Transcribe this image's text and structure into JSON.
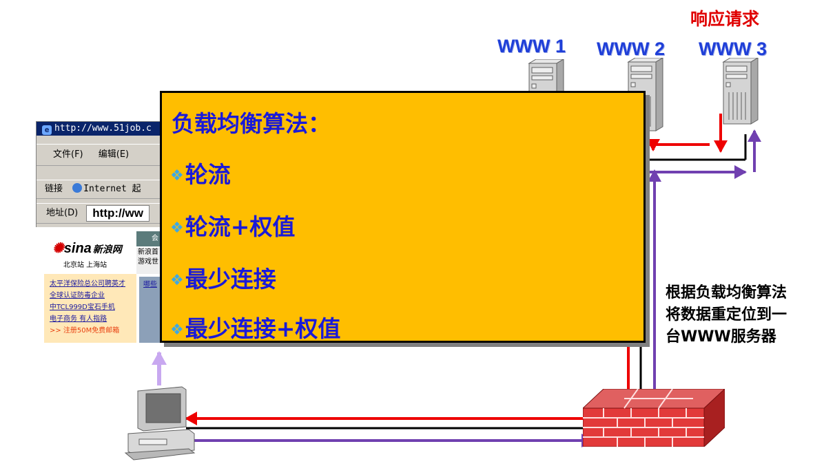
{
  "servers": {
    "request_label": "响应请求",
    "items": [
      {
        "label": "WWW 1"
      },
      {
        "label": "WWW 2"
      },
      {
        "label": "WWW 3"
      }
    ]
  },
  "browser": {
    "title": "http://www.51job.c",
    "menu": [
      "文件(F)",
      "编辑(E)"
    ],
    "links_label": "链接",
    "links_item": "Internet 起",
    "address_label": "地址(D)",
    "address_value": "http://ww"
  },
  "sina": {
    "logo": "sina",
    "logo_cn": "新浪网",
    "sub": "北京站  上海站",
    "tab": "会",
    "news": [
      "新浪首",
      "游戏世"
    ],
    "links": [
      "太平洋保险总公司聘英才",
      "全球认证防毒企业",
      "中TCL999D宝石手机",
      "电子商务 有人指路",
      ">> 注册50M免费邮箱"
    ],
    "pic_caption": "哪些"
  },
  "overlay": {
    "title": "负载均衡算法：",
    "items": [
      "轮流",
      "轮流+权值",
      "最少连接",
      "最少连接+权值"
    ]
  },
  "side_text": {
    "lines": [
      "根据负载均衡算法",
      "将数据重定位到一",
      "台WWW服务器"
    ]
  },
  "colors": {
    "red_arrow": "#ee0000",
    "purple_arrow": "#7040b0",
    "light_purple": "#c8a8f0",
    "overlay_bg": "#ffbe00",
    "blue_text": "#1a1ad8"
  }
}
